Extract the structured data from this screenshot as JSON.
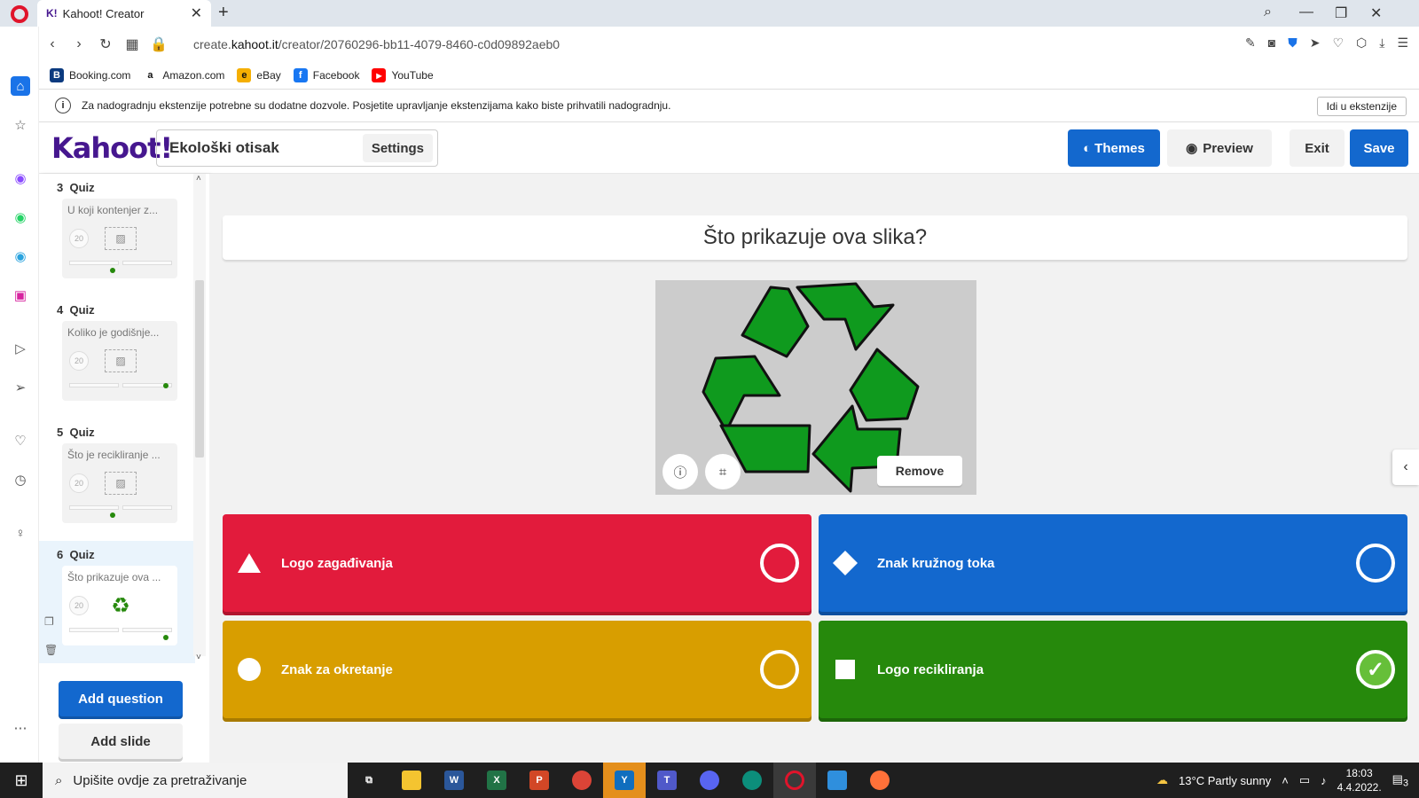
{
  "browser": {
    "tab_title": "Kahoot! Creator",
    "tab_favicon": "K!",
    "url_prefix": "create.",
    "url_domain": "kahoot.it",
    "url_path": "/creator/20760296-bb11-4079-8460-c0d09892aeb0",
    "bookmarks": [
      {
        "label": "Booking.com",
        "icon": "B",
        "color": "#0b3a7f"
      },
      {
        "label": "Amazon.com",
        "icon": "a",
        "color": "#111111"
      },
      {
        "label": "eBay",
        "icon": "e",
        "color": "#e53238"
      },
      {
        "label": "Facebook",
        "icon": "f",
        "color": "#1877f2"
      },
      {
        "label": "YouTube",
        "icon": "▶",
        "color": "#ff0000"
      }
    ],
    "info_message": "Za nadogradnju ekstenzije potrebne su dodatne dozvole. Posjetite upravljanje ekstenzijama kako biste prihvatili nadogradnju.",
    "info_button": "Idi u ekstenzije"
  },
  "header": {
    "logo": "Kahoot!",
    "kahoot_title": "Ekološki otisak",
    "settings_label": "Settings",
    "themes_label": "Themes",
    "preview_label": "Preview",
    "exit_label": "Exit",
    "save_label": "Save"
  },
  "questions": [
    {
      "number": "3",
      "type": "Quiz",
      "text": "U koji kontenjer z...",
      "time": "20"
    },
    {
      "number": "4",
      "type": "Quiz",
      "text": "Koliko je godišnje...",
      "time": "20"
    },
    {
      "number": "5",
      "type": "Quiz",
      "text": "Što je recikliranje ...",
      "time": "20"
    },
    {
      "number": "6",
      "type": "Quiz",
      "text": "Što prikazuje ova ...",
      "time": "20"
    }
  ],
  "sidebar": {
    "add_question": "Add question",
    "add_slide": "Add slide"
  },
  "editor": {
    "question": "Što prikazuje ova slika?",
    "remove_label": "Remove",
    "answers": [
      {
        "text": "Logo zagađivanja",
        "shape": "triangle",
        "color": "#e21b3c",
        "correct": false
      },
      {
        "text": "Znak kružnog toka",
        "shape": "diamond",
        "color": "#1368ce",
        "correct": false
      },
      {
        "text": "Znak za okretanje",
        "shape": "circle",
        "color": "#d89e00",
        "correct": false
      },
      {
        "text": "Logo recikliranja",
        "shape": "square",
        "color": "#26890c",
        "correct": true
      }
    ]
  },
  "taskbar": {
    "search_placeholder": "Upišite ovdje za pretraživanje",
    "weather": "13°C  Partly sunny",
    "time": "18:03",
    "date": "4.4.2022.",
    "notifications": "3"
  }
}
